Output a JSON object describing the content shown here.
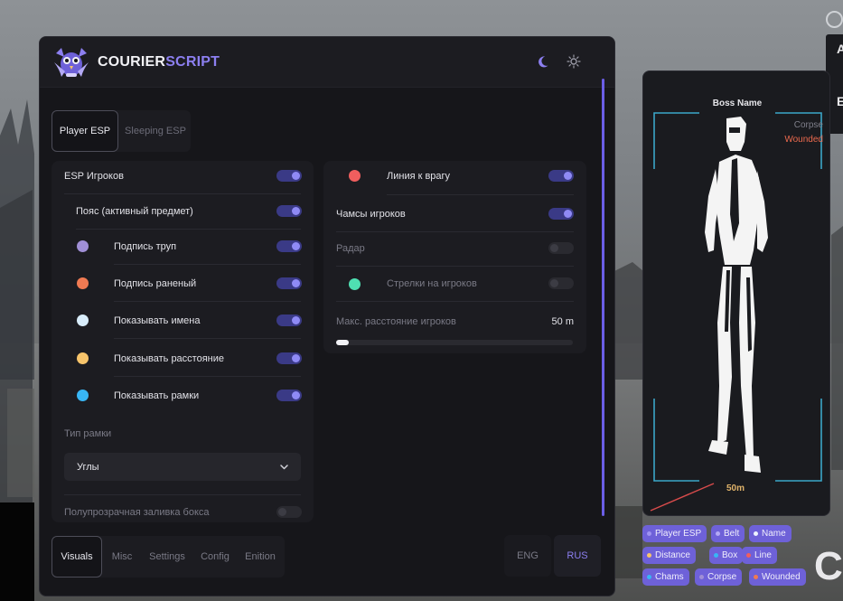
{
  "brand": {
    "part1": "COURIER",
    "part2": "SCRIPT"
  },
  "tabs": [
    {
      "label": "Player ESP",
      "active": true
    },
    {
      "label": "Sleeping ESP",
      "active": false
    }
  ],
  "left_card": {
    "main_toggle": {
      "label": "ESP Игроков",
      "on": true
    },
    "sub_toggle": {
      "label": "Пояс (активный предмет)",
      "on": true
    },
    "items": [
      {
        "label": "Подпись труп",
        "color": "#a08fd6",
        "on": true
      },
      {
        "label": "Подпись раненый",
        "color": "#f07a52",
        "on": true
      },
      {
        "label": "Показывать имена",
        "color": "#d8ecfa",
        "on": true
      },
      {
        "label": "Показывать расстояние",
        "color": "#f7c46b",
        "on": true
      },
      {
        "label": "Показывать рамки",
        "color": "#38b6f5",
        "on": true
      }
    ],
    "frame_type_label": "Тип рамки",
    "frame_type_value": "Углы",
    "fill_toggle": {
      "label": "Полупрозрачная заливка бокса",
      "on": false
    }
  },
  "right_card": {
    "enemy_line": {
      "label": "Линия к врагу",
      "color": "#f05e5e",
      "on": true
    },
    "chams": {
      "label": "Чамсы игроков",
      "on": true
    },
    "radar": {
      "label": "Радар",
      "on": false
    },
    "arrows": {
      "label": "Стрелки на игроков",
      "color": "#4fe0b2",
      "on": false
    },
    "max_distance": {
      "label": "Макс. расстояние игроков",
      "value": "50 m",
      "fraction": 0.05
    }
  },
  "bottom_nav": [
    {
      "label": "Visuals",
      "active": true
    },
    {
      "label": "Misc",
      "active": false
    },
    {
      "label": "Settings",
      "active": false
    },
    {
      "label": "Config",
      "active": false
    },
    {
      "label": "Enition",
      "active": false
    }
  ],
  "languages": [
    {
      "label": "ENG",
      "active": false
    },
    {
      "label": "RUS",
      "active": true
    }
  ],
  "preview": {
    "boss_name": "Boss Name",
    "corpse": "Corpse",
    "wounded": "Wounded",
    "distance": "50m"
  },
  "chips": [
    {
      "label": "Player ESP",
      "color": "#9f93f0"
    },
    {
      "label": "Belt",
      "color": "#b3a9f5"
    },
    {
      "label": "Name",
      "color": "#eef3ff"
    },
    {
      "label": "Distance",
      "color": "#f7c46b"
    },
    {
      "label": "Box",
      "color": "#38b6f5"
    },
    {
      "label": "Line",
      "color": "#f05e5e"
    },
    {
      "label": "Chams",
      "color": "#38b6f5"
    },
    {
      "label": "Corpse",
      "color": "#a08fd6"
    },
    {
      "label": "Wounded",
      "color": "#f07a52"
    }
  ],
  "edge": {
    "top_letter_1": "A",
    "top_letter_2": "E",
    "big_letter": "C"
  },
  "colors": {
    "accent": "#6e61d8",
    "panel": "#1c1c21",
    "window": "#16161a"
  },
  "icons": {
    "theme_dark": "moon-icon",
    "theme_light": "sun-icon",
    "dropdown": "chevron-down-icon",
    "logo": "owl-logo-icon"
  }
}
